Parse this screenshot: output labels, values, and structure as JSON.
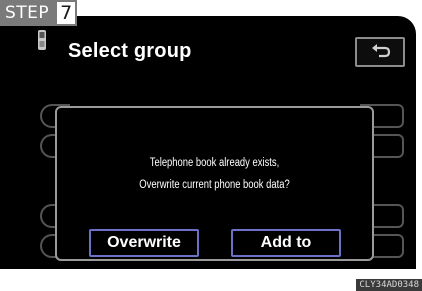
{
  "step": {
    "word": "STEP",
    "number": "7"
  },
  "screen": {
    "title": "Select group",
    "title_icon": "phone-icon",
    "back_icon": "return-arrow-icon"
  },
  "dialog": {
    "line1": "Telephone book already exists,",
    "line2": "Overwrite current phone book data?",
    "buttons": {
      "overwrite": "Overwrite",
      "add_to": "Add to"
    }
  },
  "code": "CLY34AD0348",
  "colors": {
    "screen_bg": "#000000",
    "dialog_border": "#9a9a9a",
    "button_border": "#6b71c9",
    "step_tag": "#7a7a7a"
  }
}
